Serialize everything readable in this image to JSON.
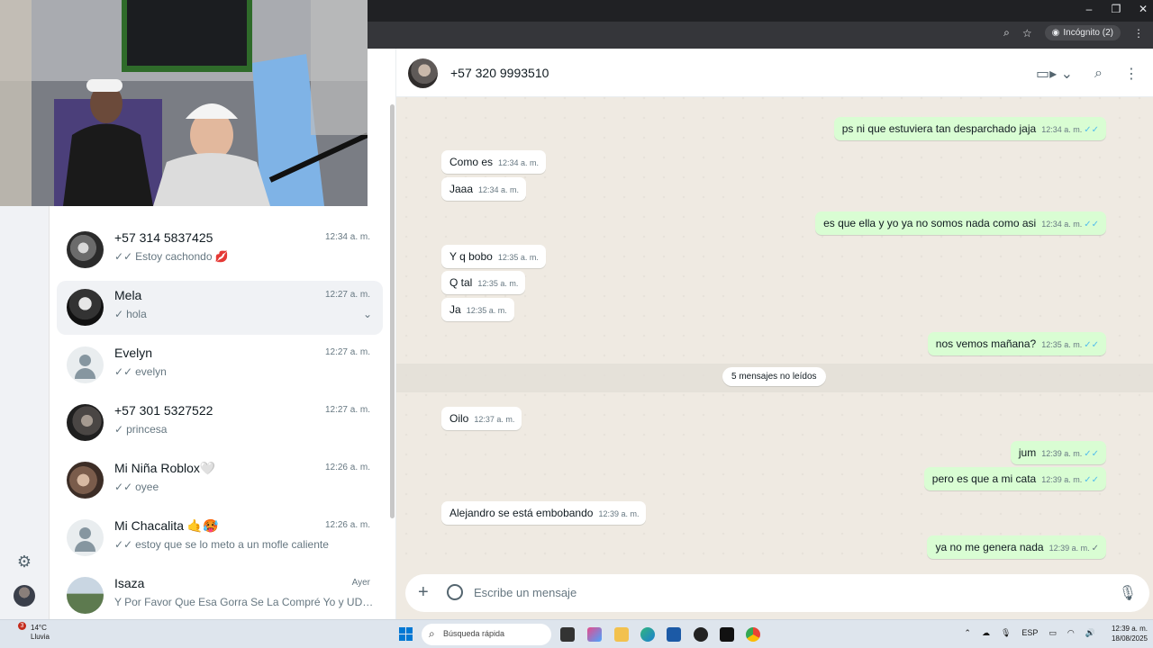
{
  "browser": {
    "incognito_label": "Incógnito (2)"
  },
  "chat_list": [
    {
      "name": "+57 314 5837425",
      "time": "12:34 a. m.",
      "preview": "Estoy cachondo 💋",
      "check": "✓✓",
      "avatar": "photo"
    },
    {
      "name": "Mela",
      "time": "12:27 a. m.",
      "preview": "hola",
      "check": "✓",
      "avatar": "photo"
    },
    {
      "name": "Evelyn",
      "time": "12:27 a. m.",
      "preview": "evelyn",
      "check": "✓✓",
      "avatar": "default"
    },
    {
      "name": "+57 301 5327522",
      "time": "12:27 a. m.",
      "preview": "princesa",
      "check": "✓",
      "avatar": "photo"
    },
    {
      "name": "Mi Niña Roblox🤍",
      "time": "12:26 a. m.",
      "preview": "oyee",
      "check": "✓✓",
      "avatar": "photo"
    },
    {
      "name": "Mi Chacalita 🤙🥵",
      "time": "12:26 a. m.",
      "preview": "estoy que se lo meto a un mofle caliente",
      "check": "✓✓",
      "avatar": "default"
    },
    {
      "name": "Isaza",
      "time": "Ayer",
      "preview": "Y Por Favor Que Esa Gorra Se La Compré Yo y UD N...",
      "check": "",
      "avatar": "photo"
    }
  ],
  "conversation": {
    "contact": "+57 320 9993510",
    "unread_label": "5 mensajes no leídos",
    "composer_placeholder": "Escribe un mensaje",
    "messages": [
      {
        "dir": "out",
        "text": "ps ni que estuviera tan desparchado jaja",
        "time": "12:34 a. m.",
        "tick": "✓✓"
      },
      {
        "dir": "in",
        "text": "Como es",
        "time": "12:34 a. m."
      },
      {
        "dir": "in",
        "text": "Jaaa",
        "time": "12:34 a. m."
      },
      {
        "dir": "out",
        "text": "es que ella y yo ya no somos nada como asi",
        "time": "12:34 a. m.",
        "tick": "✓✓"
      },
      {
        "dir": "in",
        "text": "Y q bobo",
        "time": "12:35 a. m."
      },
      {
        "dir": "in",
        "text": "Q tal",
        "time": "12:35 a. m."
      },
      {
        "dir": "in",
        "text": "Ja",
        "time": "12:35 a. m."
      },
      {
        "dir": "out",
        "text": "nos vemos mañana?",
        "time": "12:35 a. m.",
        "tick": "✓✓"
      },
      {
        "dir": "in",
        "text": "Oilo",
        "time": "12:37 a. m."
      },
      {
        "dir": "out",
        "text": "jum",
        "time": "12:39 a. m.",
        "tick": "✓✓"
      },
      {
        "dir": "out",
        "text": "pero es que a mi cata",
        "time": "12:39 a. m.",
        "tick": "✓✓"
      },
      {
        "dir": "in",
        "text": "Alejandro se está embobando",
        "time": "12:39 a. m."
      },
      {
        "dir": "out",
        "text": "ya no me genera nada",
        "time": "12:39 a. m.",
        "tick": "✓"
      }
    ]
  },
  "taskbar": {
    "weather_temp": "14°C",
    "weather_desc": "Lluvia",
    "weather_badge": "3",
    "search_label": "Búsqueda rápida",
    "lang": "ESP",
    "clock_time": "12:39 a. m.",
    "clock_date": "18/08/2025"
  },
  "colors": {
    "outgoing_bubble": "#d9fdd3",
    "incoming_bubble": "#ffffff",
    "read_tick": "#53bdeb",
    "chat_background": "#efeae2"
  }
}
